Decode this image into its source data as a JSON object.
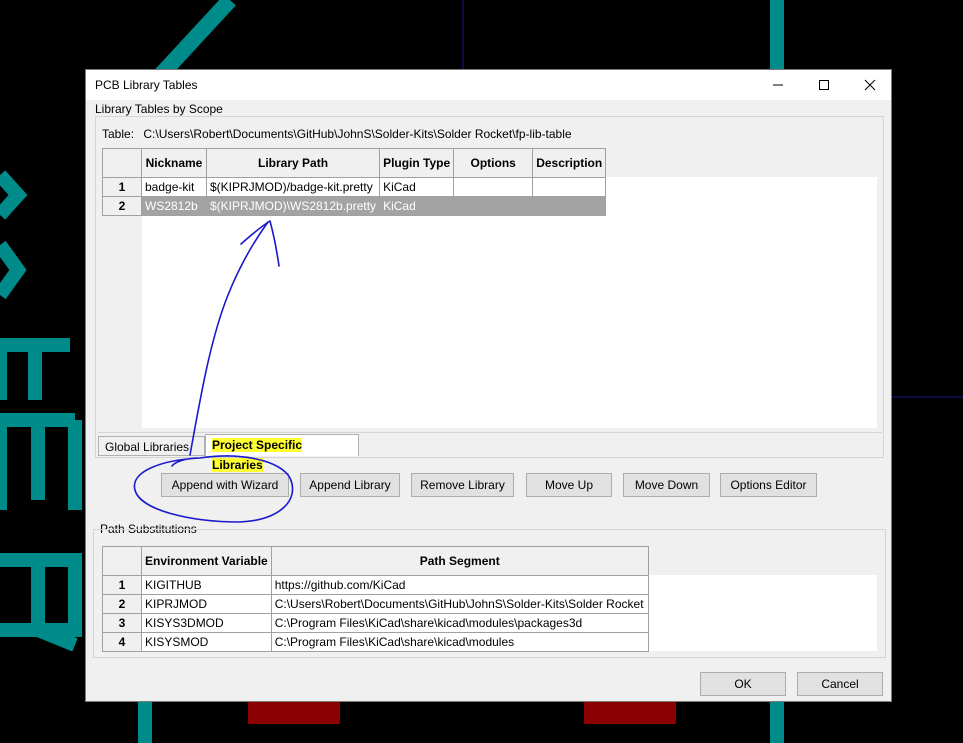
{
  "window": {
    "title": "PCB Library Tables"
  },
  "scope_group": {
    "label": "Library Tables by Scope"
  },
  "table_path": {
    "prefix": "Table:",
    "value": "C:\\Users\\Robert\\Documents\\GitHub\\JohnS\\Solder-Kits\\Solder Rocket\\fp-lib-table"
  },
  "lib_table": {
    "columns": [
      "Nickname",
      "Library Path",
      "Plugin Type",
      "Options",
      "Description"
    ],
    "rows": [
      {
        "n": "1",
        "nickname": "badge-kit",
        "path": "$(KIPRJMOD)/badge-kit.pretty",
        "plugin": "KiCad",
        "options": "",
        "description": ""
      },
      {
        "n": "2",
        "nickname": "WS2812b",
        "path": "$(KIPRJMOD)\\WS2812b.pretty",
        "plugin": "KiCad",
        "options": "",
        "description": ""
      }
    ]
  },
  "tabs": {
    "global": "Global Libraries",
    "project": "Project Specific Libraries"
  },
  "buttons": {
    "append_wizard": "Append with Wizard",
    "append_library": "Append Library",
    "remove_library": "Remove Library",
    "move_up": "Move Up",
    "move_down": "Move Down",
    "options_editor": "Options Editor",
    "ok": "OK",
    "cancel": "Cancel"
  },
  "path_subst": {
    "label": "Path Substitutions",
    "columns": [
      "Environment Variable",
      "Path Segment"
    ],
    "rows": [
      {
        "n": "1",
        "var": "KIGITHUB",
        "segment": "https://github.com/KiCad"
      },
      {
        "n": "2",
        "var": "KIPRJMOD",
        "segment": "C:\\Users\\Robert\\Documents\\GitHub\\JohnS\\Solder-Kits\\Solder Rocket"
      },
      {
        "n": "3",
        "var": "KISYS3DMOD",
        "segment": "C:\\Program Files\\KiCad\\share\\kicad\\modules\\packages3d"
      },
      {
        "n": "4",
        "var": "KISYSMOD",
        "segment": "C:\\Program Files\\KiCad\\share\\kicad\\modules"
      }
    ]
  },
  "colors": {
    "highlight": "#ffff33",
    "annotation": "#1a1acc",
    "pcb_teal": "#008b8b",
    "pad_red": "#8b0000"
  }
}
